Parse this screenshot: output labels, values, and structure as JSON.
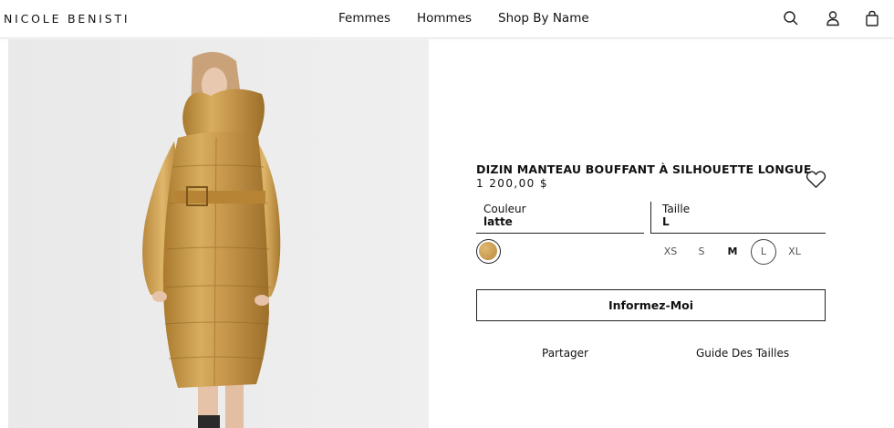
{
  "brand": {
    "logo_text": "NICOLE BENISTI"
  },
  "nav": {
    "items": [
      {
        "label": "Femmes"
      },
      {
        "label": "Hommes"
      },
      {
        "label": "Shop By Name"
      }
    ]
  },
  "header_icons": [
    "search-icon",
    "account-icon",
    "bag-icon"
  ],
  "product": {
    "title": "DIZIN MANTEAU BOUFFANT À SILHOUETTE LONGUE",
    "price": "1 200,00 $",
    "color_label": "Couleur",
    "color_value": "latte",
    "size_label": "Taille",
    "size_value": "L",
    "swatch_color": "#c99a4d",
    "sizes": [
      {
        "label": "XS"
      },
      {
        "label": "S"
      },
      {
        "label": "M"
      },
      {
        "label": "L"
      },
      {
        "label": "XL"
      }
    ],
    "notify_label": "Informez-Moi",
    "share_label": "Partager",
    "size_guide_label": "Guide Des Tailles"
  },
  "colors": {
    "accent": "#111111",
    "coat_gold": "#c79a48",
    "photo_bg": "#ececec"
  }
}
